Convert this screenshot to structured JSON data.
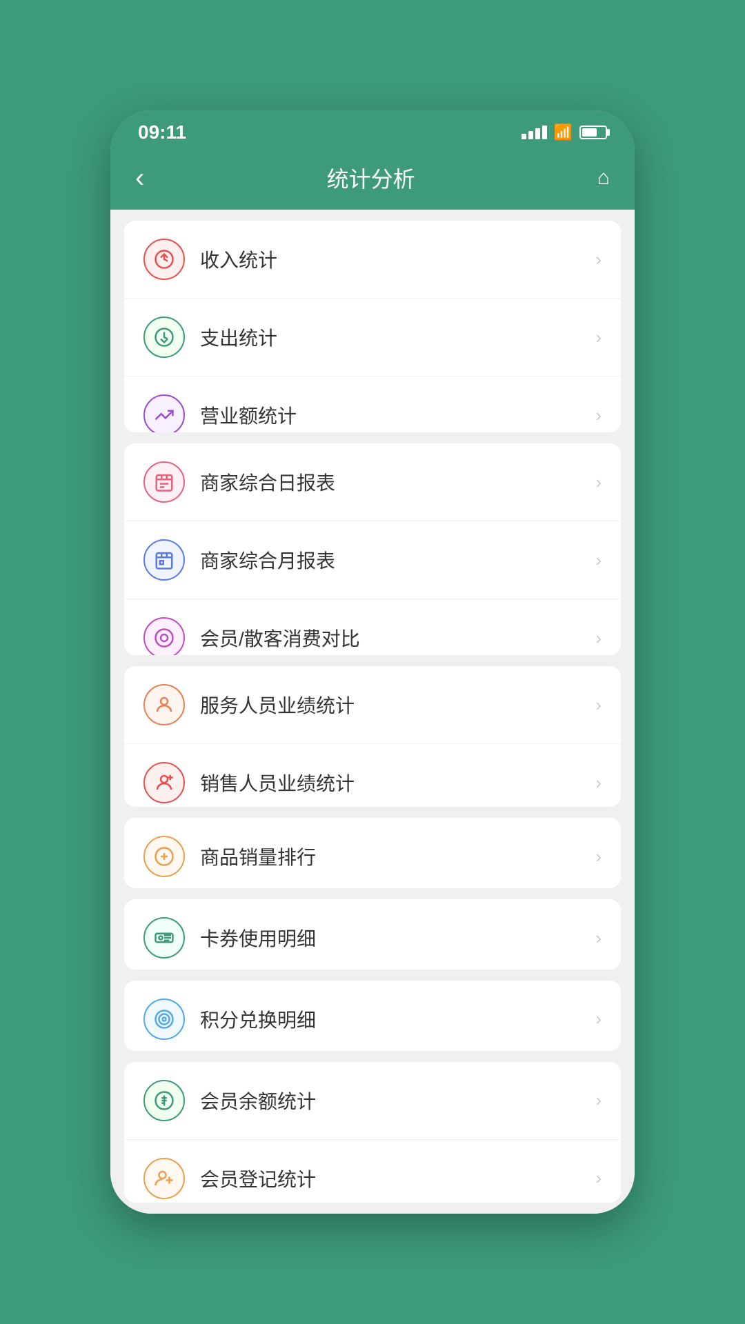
{
  "status_bar": {
    "time": "09:11"
  },
  "nav": {
    "back_label": "‹",
    "title": "统计分析",
    "home_label": "⌂"
  },
  "groups": [
    {
      "id": "group1",
      "items": [
        {
          "id": "income",
          "label": "收入统计",
          "icon_class": "icon-income",
          "icon_char": "↙"
        },
        {
          "id": "expense",
          "label": "支出统计",
          "icon_class": "icon-expense",
          "icon_char": "↗"
        },
        {
          "id": "revenue",
          "label": "营业额统计",
          "icon_class": "icon-revenue",
          "icon_char": "📈"
        }
      ]
    },
    {
      "id": "group2",
      "items": [
        {
          "id": "daily-report",
          "label": "商家综合日报表",
          "icon_class": "icon-daily",
          "icon_char": "📋"
        },
        {
          "id": "monthly-report",
          "label": "商家综合月报表",
          "icon_class": "icon-monthly",
          "icon_char": "📅"
        },
        {
          "id": "member-compare",
          "label": "会员/散客消费对比",
          "icon_class": "icon-member-compare",
          "icon_char": "⊙"
        }
      ]
    },
    {
      "id": "group3",
      "items": [
        {
          "id": "service-staff",
          "label": "服务人员业绩统计",
          "icon_class": "icon-service",
          "icon_char": "👤"
        },
        {
          "id": "sales-staff",
          "label": "销售人员业绩统计",
          "icon_class": "icon-sales",
          "icon_char": "👤"
        }
      ]
    },
    {
      "id": "group4",
      "items": [
        {
          "id": "product-rank",
          "label": "商品销量排行",
          "icon_class": "icon-product",
          "icon_char": "🏅"
        }
      ]
    },
    {
      "id": "group5",
      "items": [
        {
          "id": "coupon-detail",
          "label": "卡券使用明细",
          "icon_class": "icon-coupon",
          "icon_char": "🎫"
        }
      ]
    },
    {
      "id": "group6",
      "items": [
        {
          "id": "points-exchange",
          "label": "积分兑换明细",
          "icon_class": "icon-points",
          "icon_char": "◎"
        }
      ]
    },
    {
      "id": "group7",
      "items": [
        {
          "id": "member-balance",
          "label": "会员余额统计",
          "icon_class": "icon-member-balance",
          "icon_char": "💰"
        },
        {
          "id": "member-register",
          "label": "会员登记统计",
          "icon_class": "icon-member-register",
          "icon_char": "👤"
        }
      ]
    }
  ],
  "arrow_char": "›"
}
